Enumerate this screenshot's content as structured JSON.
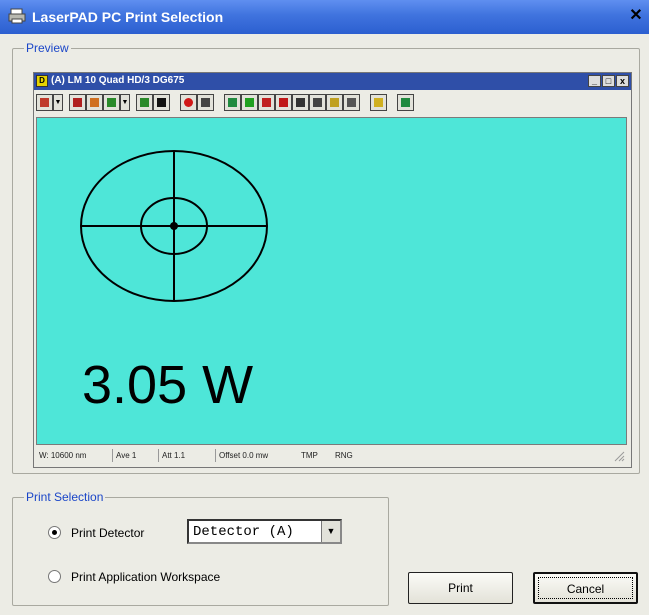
{
  "window": {
    "title": "LaserPAD PC Print Selection",
    "close_glyph": "✕"
  },
  "preview": {
    "group_label": "Preview",
    "inner_window": {
      "title": "(A) LM 10 Quad HD/3 DG675",
      "min_glyph": "_",
      "max_glyph": "□",
      "close_glyph": "x"
    },
    "display": {
      "background": "#4ee6d8",
      "reading": "3.05 W",
      "target_icon": "crosshair-target-icon"
    },
    "statusbar": {
      "wavelength": "W: 10600 nm",
      "ave": "Ave 1",
      "att": "Att 1.1",
      "offset": "Offset 0.0 mw",
      "tmp": "TMP",
      "rng": "RNG"
    }
  },
  "print_selection": {
    "group_label": "Print Selection",
    "options": [
      {
        "label": "Print Detector",
        "selected": true
      },
      {
        "label": "Print Application Workspace",
        "selected": false
      }
    ],
    "detector_select": {
      "value": "Detector (A)"
    }
  },
  "buttons": {
    "print": "Print",
    "cancel": "Cancel"
  },
  "colors": {
    "titlebar": "#3f73de",
    "group_label": "#1b46c8",
    "display": "#4ee6d8"
  }
}
